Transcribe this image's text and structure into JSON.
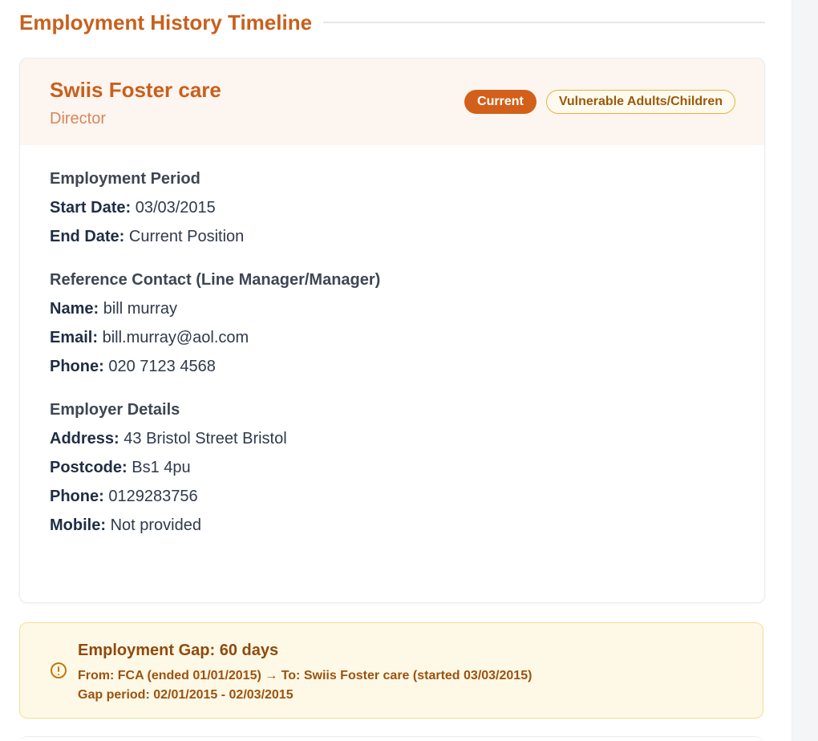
{
  "section": {
    "title": "Employment History Timeline"
  },
  "job": {
    "company": "Swiis Foster care",
    "role": "Director",
    "badges": {
      "current": "Current",
      "vulnerable": "Vulnerable Adults/Children"
    },
    "period": {
      "title": "Employment Period",
      "start_label": "Start Date:",
      "start_value": "03/03/2015",
      "end_label": "End Date:",
      "end_value": "Current Position"
    },
    "reference": {
      "title": "Reference Contact (Line Manager/Manager)",
      "name_label": "Name:",
      "name_value": "bill murray",
      "email_label": "Email:",
      "email_value": "bill.murray@aol.com",
      "phone_label": "Phone:",
      "phone_value": "020 7123 4568"
    },
    "employer": {
      "title": "Employer Details",
      "address_label": "Address:",
      "address_value": "43 Bristol Street Bristol",
      "postcode_label": "Postcode:",
      "postcode_value": "Bs1 4pu",
      "phone_label": "Phone:",
      "phone_value": "0129283756",
      "mobile_label": "Mobile:",
      "mobile_value": "Not provided"
    }
  },
  "gap": {
    "icon": "alert-circle-icon",
    "title": "Employment Gap: 60 days",
    "from_to": "From: FCA (ended 01/01/2015) → To: Swiis Foster care (started 03/03/2015)",
    "period": "Gap period: 02/01/2015 - 02/03/2015"
  },
  "colors": {
    "accent": "#c8601c",
    "badge_current_bg": "#d2601a",
    "badge_vuln_border": "#e1b43b",
    "gap_bg": "#fef9e7",
    "gap_text": "#9c520f"
  }
}
